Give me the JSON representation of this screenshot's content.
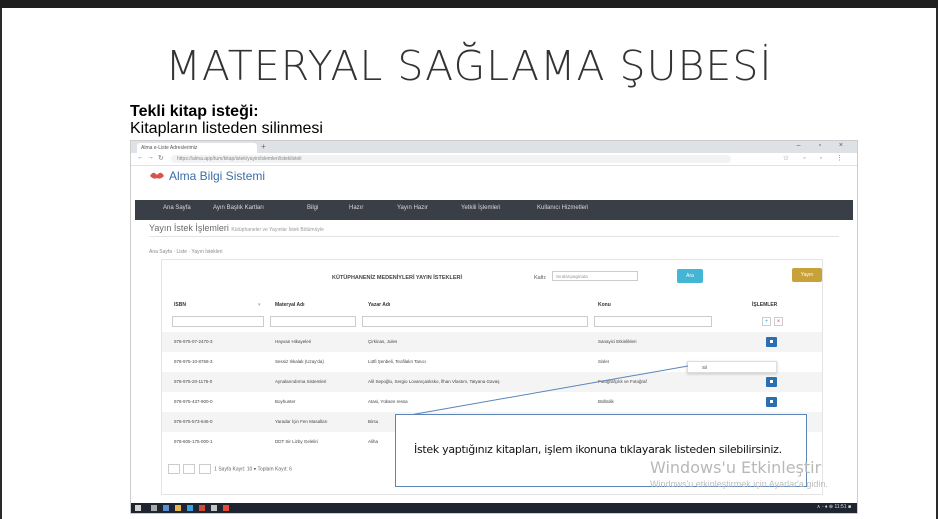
{
  "slide": {
    "title": "MATERYAL SAĞLAMA ŞUBESİ",
    "subtitle_bold": "Tekli kitap isteği:",
    "subtitle": "Kitapların listeden silinmesi"
  },
  "browser": {
    "tab_label": "Alma e-Liste Adreslerimiz",
    "new_tab": "+",
    "window_controls": "– ▫ ×",
    "url": "https://alma.app/tum/kitap/istek/yayin/islemleri/isteklisteli"
  },
  "app": {
    "name": "Alma Bilgi Sistemi",
    "nav_items": [
      "Ana Sayfa",
      "Ayın Başlık Kartları",
      "Bilgi",
      "Hazır",
      "Yayın Hazır",
      "Yetkili İşlemleri",
      "Kullanıcı Hizmetleri"
    ],
    "page_heading": "Yayın İstek İşlemleri",
    "page_heading_small": "Kütüphaneler ve Yayınlar İstek Bölümüyle",
    "breadcrumb": "Ana Sayfa · Liste · Yayın İstekleri"
  },
  "panel": {
    "title": "KÜTÜPHANENİZ MEDENİYLERİ YAYIN İSTEKLERİ",
    "filter_label": "Kaltı:",
    "filter_value": "Sıralarıpaginata",
    "search_button": "Ara",
    "gold_button": "Yayın",
    "columns": [
      "ISBN",
      "Materyal Adı",
      "Yazar Adı",
      "Konu",
      "İŞLEMLER"
    ],
    "filter_buttons": [
      "+",
      "×"
    ],
    "rows": [
      {
        "isbn": "978-975-07-2470-3",
        "title": "Hayvan Hikayeleri",
        "author": "Çirkinas, Jules",
        "subject": "Sanayici Etkinlikleri",
        "action": true
      },
      {
        "isbn": "978-975-10-8768-3",
        "title": "Sessiz Ilıkalak (Uzay'da)",
        "author": "Lütfi Şenbeli, Teofilalın Tanıcı",
        "subject": "Sisler",
        "action": false
      },
      {
        "isbn": "978-975-20-1175-0",
        "title": "Aynalarındırma Sistemleri",
        "author": "Aliİ Sepoğlu, Sergio Lovanıçasksko, İlhan Vlastım, Tatyana Gavaş",
        "subject": "Fotoğrafçılık ve Fotoğraf",
        "action": true
      },
      {
        "isbn": "978-975-437-900-0",
        "title": "Boyhunter",
        "author": "Atasi, Yüksen ressa",
        "subject": "Bülbülik",
        "action": true
      },
      {
        "isbn": "978-975-573-646-0",
        "title": "Yaradar İçin Fen Masalları",
        "author": "Birsu",
        "subject": "",
        "action": false
      },
      {
        "isbn": "978-605-175-000-1",
        "title": "DDT Sir Lizby Geleliri",
        "author": "Aliha",
        "subject": "",
        "action": false
      }
    ],
    "popover_text": "Sil",
    "pager_text": "1 Sayfa Kayıt: 10  ▾  Toplam Kayıt: 6"
  },
  "taskbar": {
    "tray": "∧ ◦ ♦ ⊕  11:51  ■"
  },
  "callout": {
    "text": "İstek yaptığınız kitapları, işlem ikonuna tıklayarak listeden silebilirsiniz."
  },
  "watermark": {
    "line1": "Windows'u Etkinleştir",
    "line2": "Windows'u etkinleştirmek için Ayarlar'a gidin."
  },
  "colors": {
    "navbar": "#3a3f47",
    "action_button": "#2a6eb4",
    "search_button": "#42b6d4",
    "gold_button": "#c9a13a",
    "callout_border": "#5b84b8"
  }
}
